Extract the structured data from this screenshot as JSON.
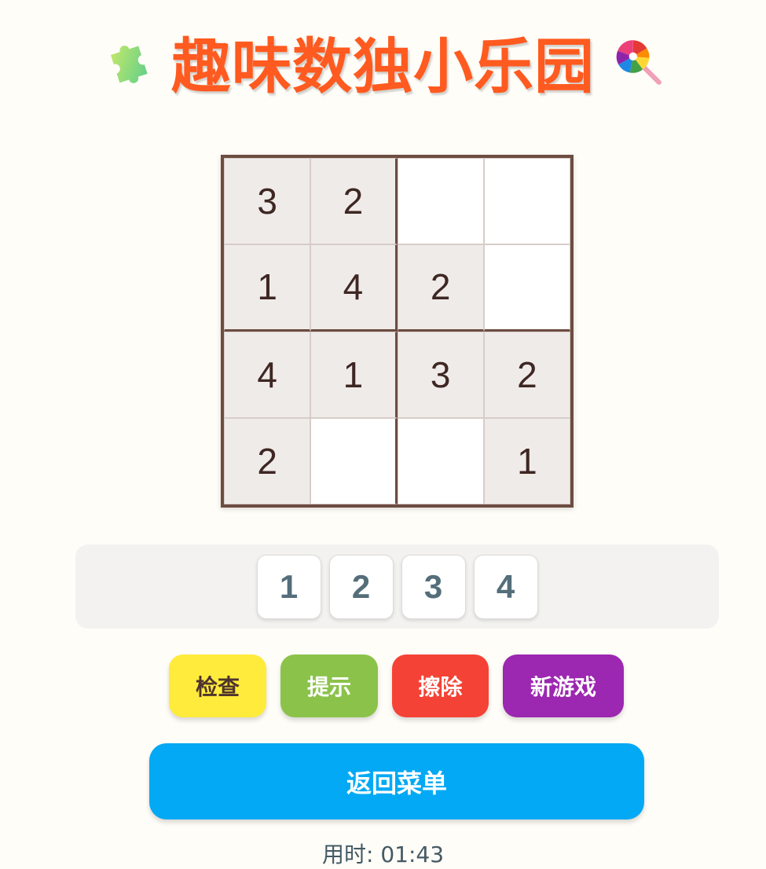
{
  "header": {
    "title": "趣味数独小乐园",
    "left_icon": "puzzle-piece-icon",
    "right_icon": "lollipop-icon"
  },
  "board": {
    "size": 4,
    "rows": [
      [
        "3",
        "2",
        "",
        ""
      ],
      [
        "1",
        "4",
        "2",
        ""
      ],
      [
        "4",
        "1",
        "3",
        "2"
      ],
      [
        "2",
        "",
        "",
        "1"
      ]
    ]
  },
  "number_pad": [
    "1",
    "2",
    "3",
    "4"
  ],
  "actions": {
    "check": "检查",
    "hint": "提示",
    "erase": "擦除",
    "new_game": "新游戏"
  },
  "menu": {
    "back_label": "返回菜单"
  },
  "timer": {
    "text": "用时: 01:43"
  },
  "colors": {
    "title": "#ff5a1f",
    "board_border": "#6d4c41",
    "check": "#ffeb3b",
    "hint": "#8bc34a",
    "erase": "#f44336",
    "new_game": "#9c27b0",
    "menu": "#03a9f4"
  }
}
